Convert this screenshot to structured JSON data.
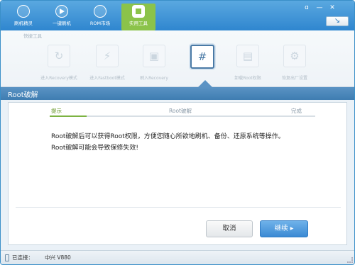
{
  "nav": {
    "items": [
      {
        "label": "刷机精灵",
        "icon": "logo-icon"
      },
      {
        "label": "一键刷机",
        "icon": "play-icon"
      },
      {
        "label": "ROM市场",
        "icon": "android-icon"
      },
      {
        "label": "实用工具",
        "icon": "tools-icon",
        "active": true
      }
    ],
    "controls": {
      "settings": "ɑ",
      "minimize": "—",
      "close": "✕"
    },
    "refresh_glyph": "↘"
  },
  "toolstrip": {
    "title": "快捷工具",
    "tools": [
      {
        "label": "进入Recovery模式",
        "glyph": "↻"
      },
      {
        "label": "进入Fastboot模式",
        "glyph": "⚡"
      },
      {
        "label": "刷入Recovery",
        "glyph": "▣"
      },
      {
        "label": "",
        "glyph": "#",
        "active": true
      },
      {
        "label": "卸载Root权限",
        "glyph": "▤"
      },
      {
        "label": "恢复出厂设置",
        "glyph": "⚙"
      }
    ]
  },
  "section": {
    "title": "Root破解"
  },
  "steps": {
    "labels": [
      "提示",
      "Root破解",
      "完成"
    ],
    "progress": 0.14
  },
  "message": {
    "line1": "Root破解后可以获得Root权限，方便您随心所欲地刷机、备份、还原系统等操作。",
    "line2": "Root破解可能会导致保修失效!"
  },
  "buttons": {
    "cancel": "取消",
    "continue": "继续"
  },
  "status": {
    "connection": "已连接：",
    "device": "中兴 V880"
  },
  "colors": {
    "accent": "#2f86cf",
    "active_tab": "#8bc34a",
    "primary_button": "#3b8ad4"
  }
}
